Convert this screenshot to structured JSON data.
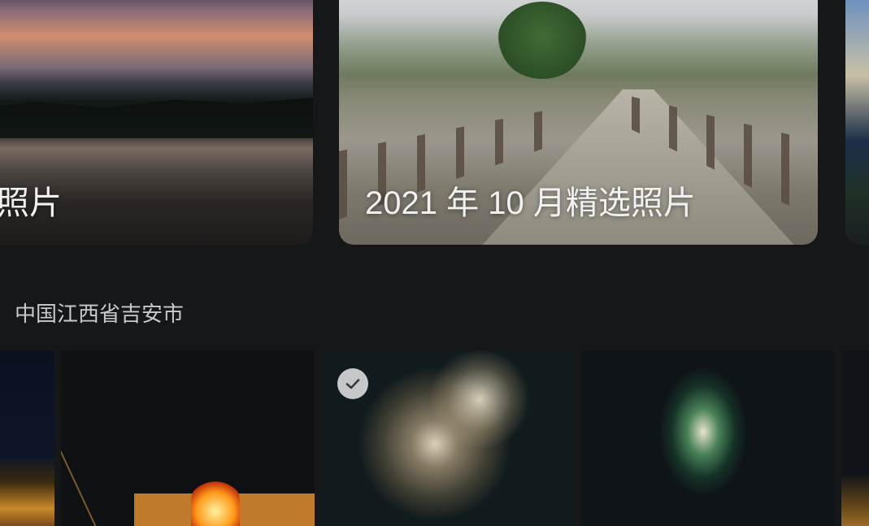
{
  "highlights": [
    {
      "title": "选照片"
    },
    {
      "title": "2021 年 10 月精选照片"
    },
    {
      "title": ""
    }
  ],
  "section": {
    "title": "中国江西省吉安市"
  },
  "photos": [
    {
      "subject": "night-scene",
      "selected": false
    },
    {
      "subject": "bonfire",
      "selected": false
    },
    {
      "subject": "fireworks",
      "selected": true
    },
    {
      "subject": "green-fireworks",
      "selected": false
    },
    {
      "subject": "night-scene",
      "selected": false
    }
  ],
  "icons": {
    "select": "check-circle-icon"
  },
  "colors": {
    "background": "#161719",
    "text": "#f1f1f1",
    "section_text": "#c9cacc"
  }
}
